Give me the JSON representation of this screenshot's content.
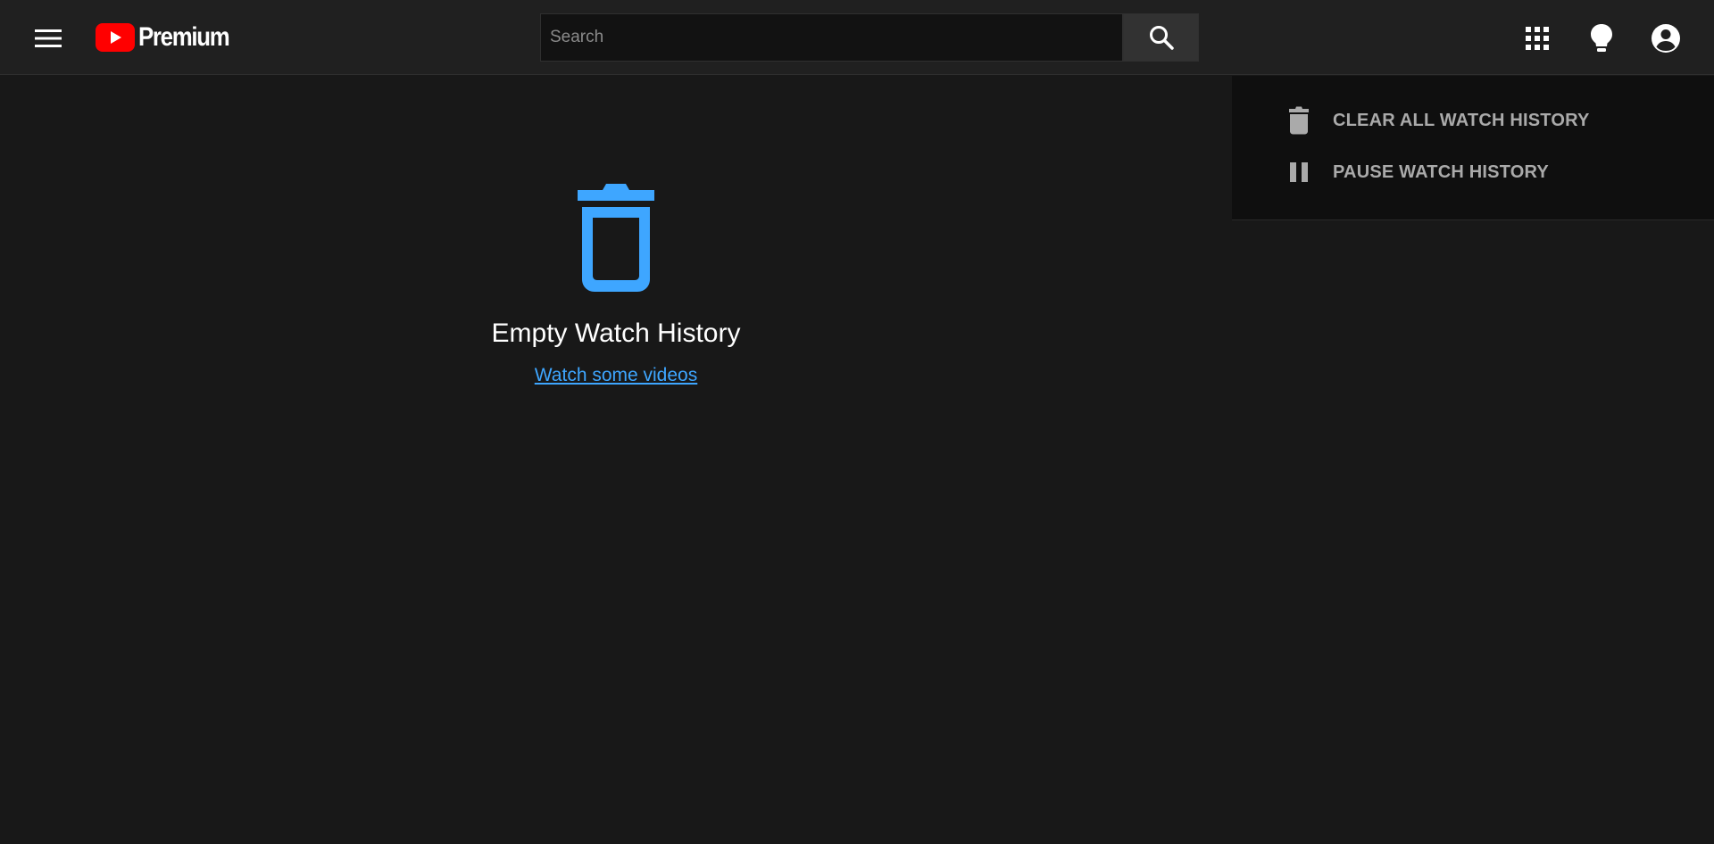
{
  "header": {
    "brand": "Premium",
    "search": {
      "placeholder": "Search",
      "value": ""
    },
    "icons": [
      "menu-icon",
      "youtube-logo-icon",
      "search-icon",
      "apps-grid-icon",
      "lightbulb-icon",
      "account-icon"
    ]
  },
  "main": {
    "empty_icon": "trash-icon",
    "empty_title": "Empty Watch History",
    "empty_link": "Watch some videos"
  },
  "side_panel": {
    "items": [
      {
        "icon": "trash-icon",
        "label": "CLEAR ALL WATCH HISTORY"
      },
      {
        "icon": "pause-icon",
        "label": "PAUSE WATCH HISTORY"
      }
    ]
  },
  "colors": {
    "background": "#181818",
    "header": "#202020",
    "panel": "#0f0f0f",
    "accent": "#3ea6ff",
    "brand_red": "#ff0000",
    "muted_text": "#aaaaaa"
  }
}
